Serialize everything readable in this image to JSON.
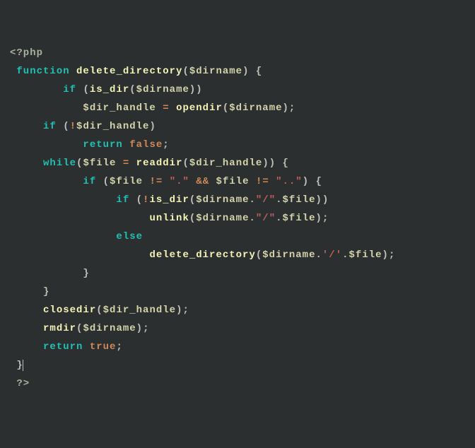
{
  "php_open": "<?php",
  "php_close": "?>",
  "kw": {
    "function": "function",
    "if": "if",
    "return": "return",
    "while": "while",
    "else": "else"
  },
  "fn": {
    "delete_directory": "delete_directory",
    "is_dir": "is_dir",
    "opendir": "opendir",
    "readdir": "readdir",
    "unlink": "unlink",
    "closedir": "closedir",
    "rmdir": "rmdir"
  },
  "var": {
    "dirname": "$dirname",
    "dir_handle": "$dir_handle",
    "file": "$file"
  },
  "str": {
    "dot": "\".\"",
    "dotdot": "\"..\"",
    "slash_dq": "\"/\"",
    "slash_sq": "'/'"
  },
  "bool": {
    "false": "false",
    "true": "true"
  },
  "p": {
    "lparen": "(",
    "rparen": ")",
    "lbrace": "{",
    "rbrace": "}",
    "semi": ";",
    "dot": ".",
    "comma": ",",
    "rbrace_cursor": "}"
  },
  "op": {
    "assign": "=",
    "neq": "!=",
    "and": "&&",
    "not": "!"
  }
}
